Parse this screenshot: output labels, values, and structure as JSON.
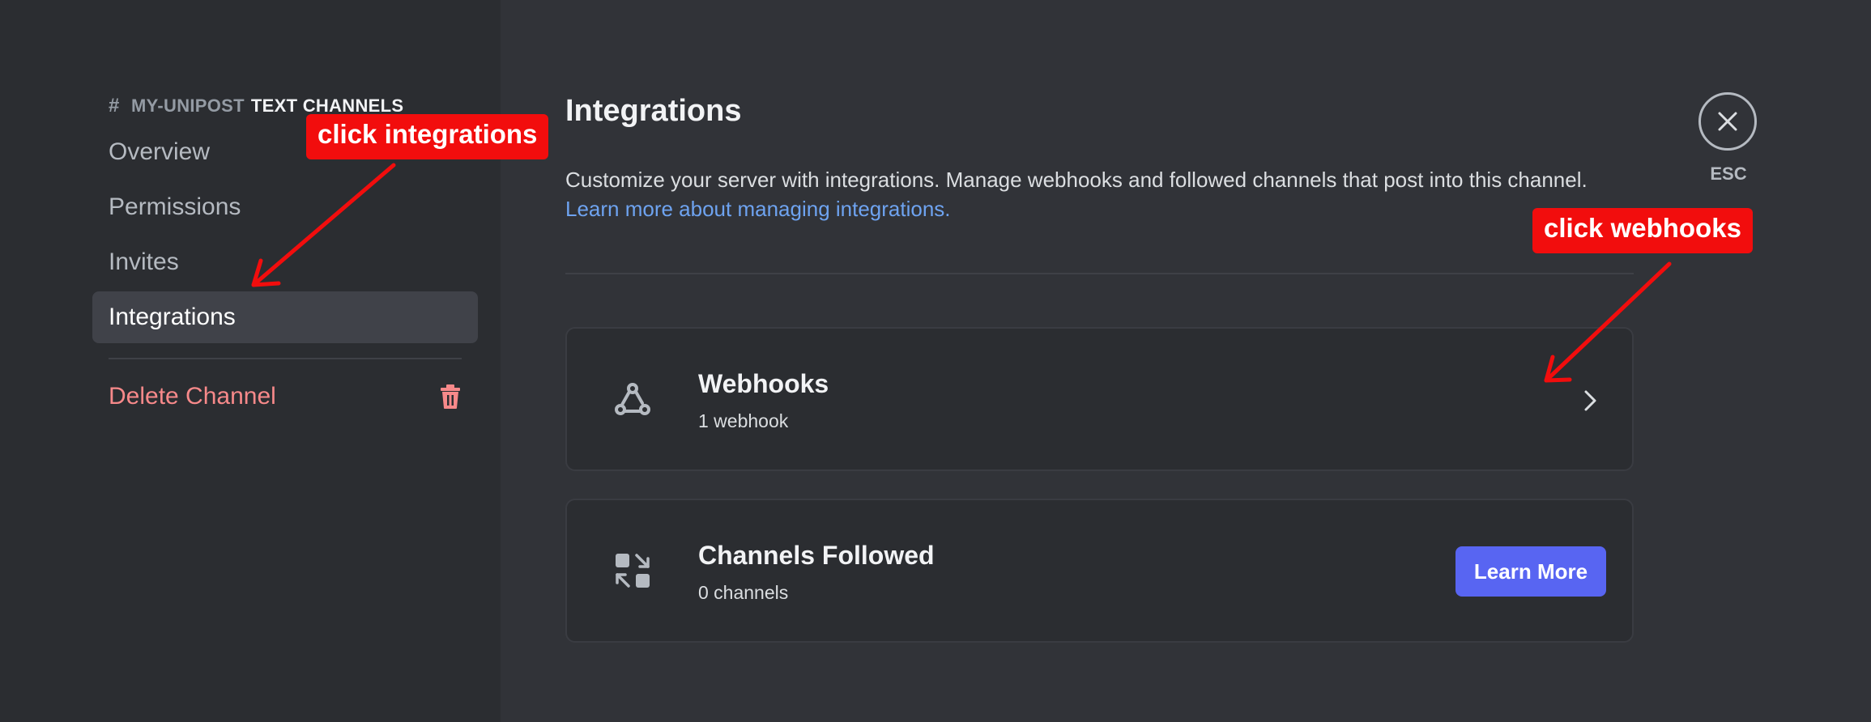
{
  "sidebar": {
    "header": {
      "channel_name": "MY-UNIPOST",
      "category": "TEXT CHANNELS"
    },
    "items": [
      {
        "label": "Overview",
        "active": false
      },
      {
        "label": "Permissions",
        "active": false
      },
      {
        "label": "Invites",
        "active": false
      },
      {
        "label": "Integrations",
        "active": true
      }
    ],
    "delete_label": "Delete Channel"
  },
  "main": {
    "title": "Integrations",
    "description": "Customize your server with integrations. Manage webhooks and followed channels that post into this channel.",
    "learn_link": "Learn more about managing integrations.",
    "cards": [
      {
        "title": "Webhooks",
        "subtitle": "1 webhook",
        "icon": "webhook-icon"
      },
      {
        "title": "Channels Followed",
        "subtitle": "0 channels",
        "icon": "channels-followed-icon",
        "button": "Learn More"
      }
    ],
    "close_label": "ESC"
  },
  "annotations": {
    "first": "click integrations",
    "second": "click webhooks"
  },
  "colors": {
    "sidebar_bg": "#2b2d31",
    "main_bg": "#313338",
    "accent": "#5865f2",
    "link": "#6ea3f0",
    "danger": "#f7898a",
    "annotation": "#f20d0d"
  }
}
